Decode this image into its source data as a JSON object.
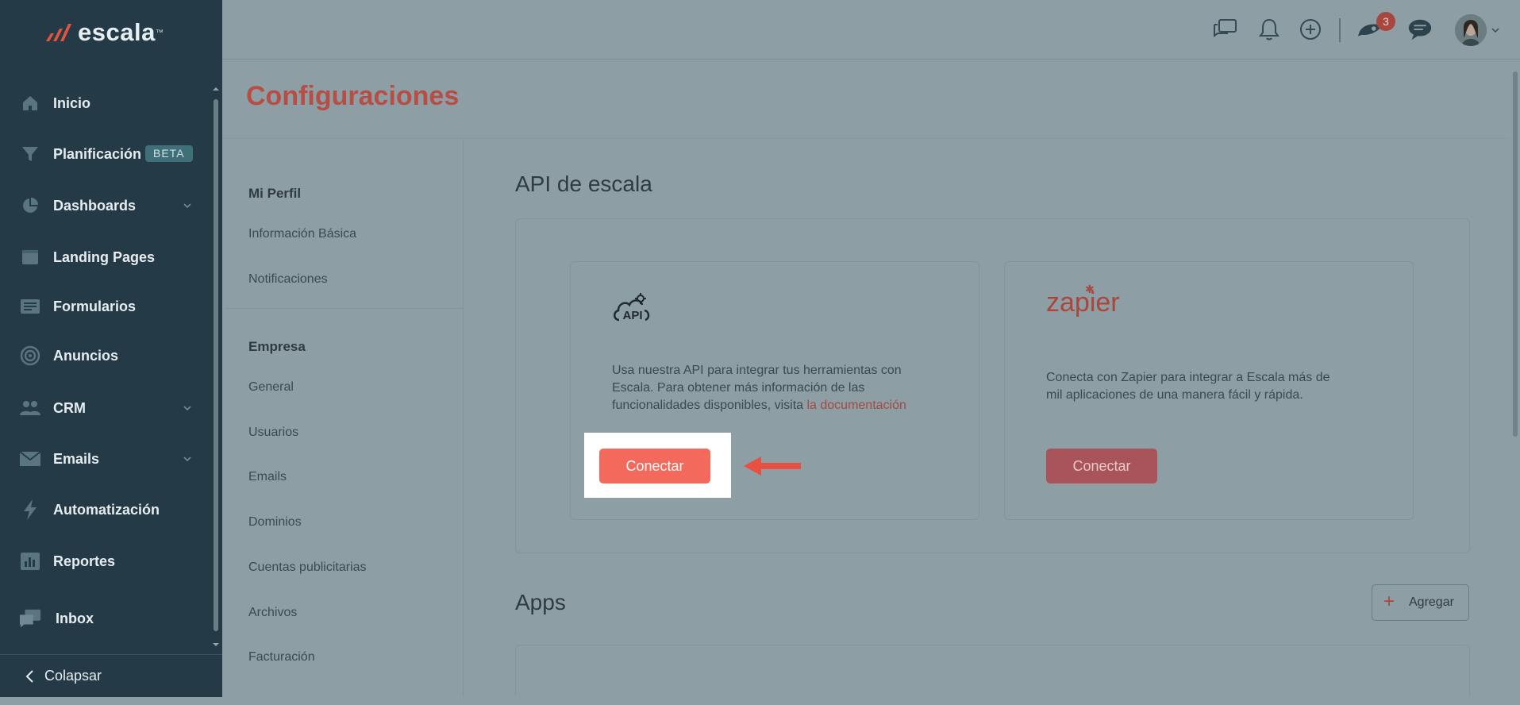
{
  "app": {
    "logo_text": "escala",
    "logo_tm": "™"
  },
  "sidebar": {
    "items": [
      {
        "label": "Inicio",
        "icon": "home-icon"
      },
      {
        "label": "Planificación",
        "icon": "funnel-icon",
        "badge": "BETA"
      },
      {
        "label": "Dashboards",
        "icon": "pie-chart-icon",
        "has_submenu": true
      },
      {
        "label": "Landing Pages",
        "icon": "browser-window-icon"
      },
      {
        "label": "Formularios",
        "icon": "form-icon"
      },
      {
        "label": "Anuncios",
        "icon": "target-icon"
      },
      {
        "label": "CRM",
        "icon": "people-icon",
        "has_submenu": true
      },
      {
        "label": "Emails",
        "icon": "envelope-icon",
        "has_submenu": true
      },
      {
        "label": "Automatización",
        "icon": "lightning-icon"
      },
      {
        "label": "Reportes",
        "icon": "bar-report-icon"
      },
      {
        "label": "Inbox",
        "icon": "chat-bubbles-icon"
      }
    ],
    "collapse_label": "Colapsar"
  },
  "topbar": {
    "notification_count": "3"
  },
  "page": {
    "title": "Configuraciones"
  },
  "settings_nav": {
    "groups": [
      {
        "heading": "Mi Perfil",
        "items": [
          "Información Básica",
          "Notificaciones"
        ]
      },
      {
        "heading": "Empresa",
        "items": [
          "General",
          "Usuarios",
          "Emails",
          "Dominios",
          "Cuentas publicitarias",
          "Archivos",
          "Facturación"
        ]
      }
    ]
  },
  "api_section": {
    "title": "API de escala",
    "api_card": {
      "icon_label": "API",
      "desc_line1": "Usa nuestra API para integrar tus herramientas con",
      "desc_line2": "Escala. Para obtener más información de las",
      "desc_line3": "funcionalidades disponibles, visita ",
      "link_text": "la documentación",
      "button_label": "Conectar"
    },
    "zapier_card": {
      "logo_text": "zapier",
      "desc_line1": "Conecta con Zapier para integrar a Escala más de",
      "desc_line2": "mil aplicaciones de una manera fácil y rápida.",
      "button_label": "Conectar"
    }
  },
  "apps_section": {
    "title": "Apps",
    "add_label": "Agregar"
  },
  "colors": {
    "sidebar_bg": "#243b47",
    "overlay_bg": "#8d9ea4",
    "brand_accent": "#f3695b",
    "title_accent": "#b74e45",
    "arrow": "#e8503f"
  }
}
